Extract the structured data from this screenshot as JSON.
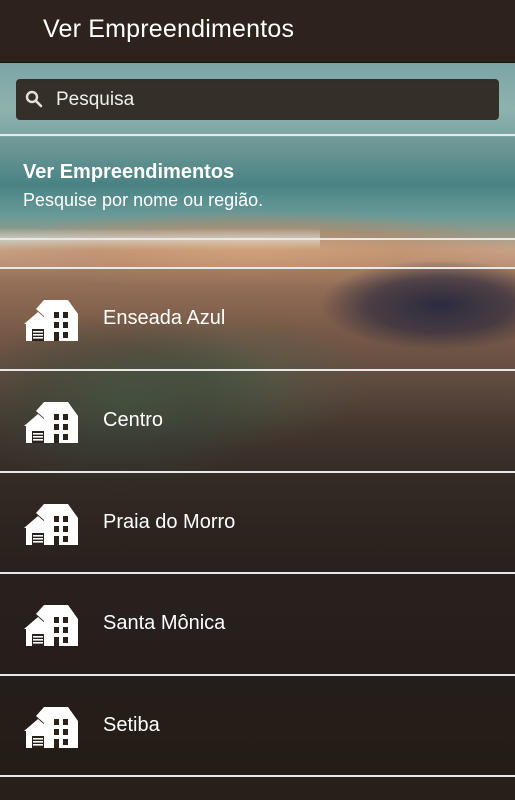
{
  "app_bar": {
    "title": "Ver Empreendimentos"
  },
  "search": {
    "placeholder": "Pesquisa",
    "icon": "search-icon"
  },
  "list_header": {
    "title": "Ver Empreendimentos",
    "subtitle": "Pesquise por nome ou região."
  },
  "items": [
    {
      "label": "Enseada Azul",
      "icon": "house-icon"
    },
    {
      "label": "Centro",
      "icon": "house-icon"
    },
    {
      "label": "Praia do Morro",
      "icon": "house-icon"
    },
    {
      "label": "Santa Mônica",
      "icon": "house-icon"
    },
    {
      "label": "Setiba",
      "icon": "house-icon"
    }
  ],
  "colors": {
    "app_bar": "#2e231c",
    "search_bg": "#2e241e",
    "divider": "#e8e8e8",
    "text": "#ffffff"
  }
}
